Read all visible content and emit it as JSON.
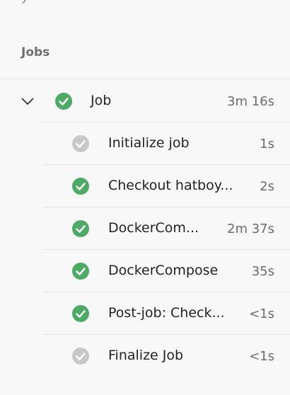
{
  "header": {
    "cut_text": "y",
    "section_title": "Jobs"
  },
  "job": {
    "label": "Job",
    "duration": "3m 16s",
    "status": "success",
    "expanded": true
  },
  "steps": [
    {
      "label": "Initialize job",
      "duration": "1s",
      "status": "skipped"
    },
    {
      "label": "Checkout hatboy...",
      "duration": "2s",
      "status": "success"
    },
    {
      "label": "DockerCom...",
      "duration": "2m 37s",
      "status": "success"
    },
    {
      "label": "DockerCompose",
      "duration": "35s",
      "status": "success"
    },
    {
      "label": "Post-job: Check...",
      "duration": "<1s",
      "status": "success"
    },
    {
      "label": "Finalize Job",
      "duration": "<1s",
      "status": "skipped"
    }
  ],
  "colors": {
    "success": "#4caa64",
    "skipped": "#c8c8c8",
    "background": "#f8f8f8",
    "divider": "#e4e4e4"
  },
  "icons": {
    "success": "check-circle-icon",
    "skipped": "check-circle-gray-icon",
    "expand": "chevron-down-icon"
  }
}
